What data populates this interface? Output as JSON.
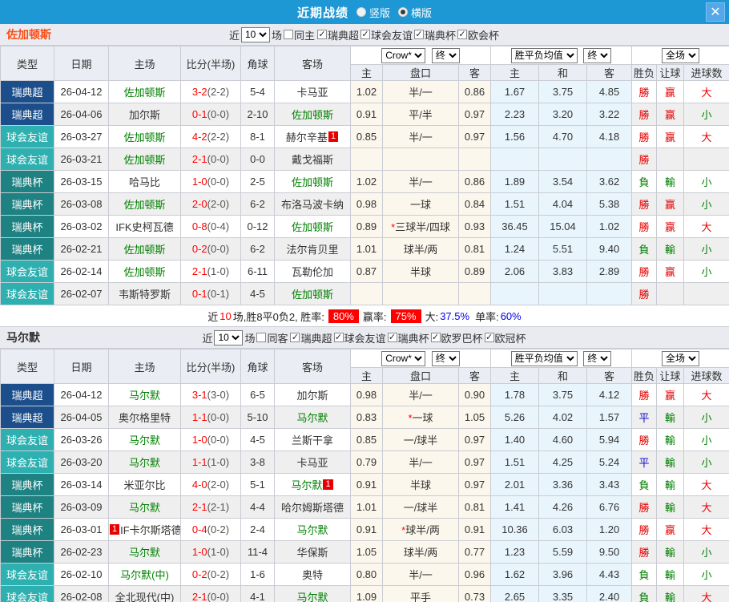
{
  "titlebar": {
    "title": "近期战绩",
    "radio_vertical": "竖版",
    "radio_horizontal": "横版",
    "selected_layout": "横版",
    "close_glyph": "✕"
  },
  "labels": {
    "near": "近",
    "games": "场"
  },
  "table_header": {
    "cols": [
      "类型",
      "日期",
      "主场",
      "比分(半场)",
      "角球",
      "客场"
    ],
    "dd_odds_company": "Crow*",
    "dd_final": "终",
    "dd_avg": "胜平负均值",
    "dd_scope": "全场",
    "subcols": [
      "主",
      "盘口",
      "客",
      "主",
      "和",
      "客",
      "胜负",
      "让球",
      "进球数"
    ]
  },
  "league_colors": {
    "瑞典超": "#1b4e8b",
    "球会友谊": "#2fb0b0",
    "瑞典杯": "#1e8182"
  },
  "colors": {
    "titlebar": "#1e97d5",
    "win": "#e60000",
    "lose": "#008000",
    "draw": "#1414cc",
    "score": "#ff0000",
    "cream_col": "#fcf7ec",
    "pale_col": "#e9f5fc"
  },
  "sections": [
    {
      "team": "佐加顿斯",
      "team_color": "#ff4b12",
      "filters": {
        "count": "10",
        "same_label": "同主",
        "same_checked": false,
        "leagues": [
          {
            "label": "瑞典超",
            "checked": true
          },
          {
            "label": "球会友谊",
            "checked": true
          },
          {
            "label": "瑞典杯",
            "checked": true
          },
          {
            "label": "欧会杯",
            "checked": true
          }
        ]
      },
      "rows": [
        {
          "league": "瑞典超",
          "date": "26-04-12",
          "home": "佐加顿斯",
          "home_self": true,
          "home_badge": "",
          "home_badge_before": false,
          "score": "3-2",
          "half": "(2-2)",
          "corner": "5-4",
          "away": "卡马亚",
          "away_self": false,
          "away_badge": "",
          "o1": "1.02",
          "pan": "半/一",
          "o2": "0.86",
          "a1": "1.67",
          "a2": "3.75",
          "a3": "4.85",
          "wdl": "勝",
          "cover": "赢",
          "ou": "大"
        },
        {
          "league": "瑞典超",
          "date": "26-04-06",
          "home": "加尔斯",
          "home_self": false,
          "home_badge": "",
          "home_badge_before": false,
          "score": "0-1",
          "half": "(0-0)",
          "corner": "2-10",
          "away": "佐加顿斯",
          "away_self": true,
          "away_badge": "",
          "o1": "0.91",
          "pan": "平/半",
          "o2": "0.97",
          "a1": "2.23",
          "a2": "3.20",
          "a3": "3.22",
          "wdl": "勝",
          "cover": "赢",
          "ou": "小"
        },
        {
          "league": "球会友谊",
          "date": "26-03-27",
          "home": "佐加顿斯",
          "home_self": true,
          "home_badge": "",
          "home_badge_before": false,
          "score": "4-2",
          "half": "(2-2)",
          "corner": "8-1",
          "away": "赫尔辛基",
          "away_self": false,
          "away_badge": "1",
          "o1": "0.85",
          "pan": "半/一",
          "o2": "0.97",
          "a1": "1.56",
          "a2": "4.70",
          "a3": "4.18",
          "wdl": "勝",
          "cover": "赢",
          "ou": "大"
        },
        {
          "league": "球会友谊",
          "date": "26-03-21",
          "home": "佐加顿斯",
          "home_self": true,
          "home_badge": "",
          "home_badge_before": false,
          "score": "2-1",
          "half": "(0-0)",
          "corner": "0-0",
          "away": "戴戈福斯",
          "away_self": false,
          "away_badge": "",
          "o1": "",
          "pan": "",
          "o2": "",
          "a1": "",
          "a2": "",
          "a3": "",
          "wdl": "勝",
          "cover": "",
          "ou": ""
        },
        {
          "league": "瑞典杯",
          "date": "26-03-15",
          "home": "哈马比",
          "home_self": false,
          "home_badge": "",
          "home_badge_before": false,
          "score": "1-0",
          "half": "(0-0)",
          "corner": "2-5",
          "away": "佐加顿斯",
          "away_self": true,
          "away_badge": "",
          "o1": "1.02",
          "pan": "半/一",
          "o2": "0.86",
          "a1": "1.89",
          "a2": "3.54",
          "a3": "3.62",
          "wdl": "負",
          "cover": "輸",
          "ou": "小"
        },
        {
          "league": "瑞典杯",
          "date": "26-03-08",
          "home": "佐加顿斯",
          "home_self": true,
          "home_badge": "",
          "home_badge_before": false,
          "score": "2-0",
          "half": "(2-0)",
          "corner": "6-2",
          "away": "布洛马波卡纳",
          "away_self": false,
          "away_badge": "",
          "o1": "0.98",
          "pan": "一球",
          "o2": "0.84",
          "a1": "1.51",
          "a2": "4.04",
          "a3": "5.38",
          "wdl": "勝",
          "cover": "赢",
          "ou": "小"
        },
        {
          "league": "瑞典杯",
          "date": "26-03-02",
          "home": "IFK史柯瓦德",
          "home_self": false,
          "home_badge": "",
          "home_badge_before": false,
          "score": "0-8",
          "half": "(0-4)",
          "corner": "0-12",
          "away": "佐加顿斯",
          "away_self": true,
          "away_badge": "",
          "o1": "0.89",
          "pan": "*三球半/四球",
          "o2": "0.93",
          "a1": "36.45",
          "a2": "15.04",
          "a3": "1.02",
          "wdl": "勝",
          "cover": "赢",
          "ou": "大"
        },
        {
          "league": "瑞典杯",
          "date": "26-02-21",
          "home": "佐加顿斯",
          "home_self": true,
          "home_badge": "",
          "home_badge_before": false,
          "score": "0-2",
          "half": "(0-0)",
          "corner": "6-2",
          "away": "法尔肯贝里",
          "away_self": false,
          "away_badge": "",
          "o1": "1.01",
          "pan": "球半/两",
          "o2": "0.81",
          "a1": "1.24",
          "a2": "5.51",
          "a3": "9.40",
          "wdl": "負",
          "cover": "輸",
          "ou": "小"
        },
        {
          "league": "球会友谊",
          "date": "26-02-14",
          "home": "佐加顿斯",
          "home_self": true,
          "home_badge": "",
          "home_badge_before": false,
          "score": "2-1",
          "half": "(1-0)",
          "corner": "6-11",
          "away": "瓦勒伦加",
          "away_self": false,
          "away_badge": "",
          "o1": "0.87",
          "pan": "半球",
          "o2": "0.89",
          "a1": "2.06",
          "a2": "3.83",
          "a3": "2.89",
          "wdl": "勝",
          "cover": "赢",
          "ou": "小"
        },
        {
          "league": "球会友谊",
          "date": "26-02-07",
          "home": "韦斯特罗斯",
          "home_self": false,
          "home_badge": "",
          "home_badge_before": false,
          "score": "0-1",
          "half": "(0-1)",
          "corner": "4-5",
          "away": "佐加顿斯",
          "away_self": true,
          "away_badge": "",
          "o1": "",
          "pan": "",
          "o2": "",
          "a1": "",
          "a2": "",
          "a3": "",
          "wdl": "勝",
          "cover": "",
          "ou": ""
        }
      ],
      "summary": {
        "prefix": "近",
        "count": "10",
        "record": "场,胜8平0负2, 胜率:",
        "win_rate": "80%",
        "profit_label": "赢率:",
        "profit_rate": "75%",
        "big_label": "大:",
        "big_value": "37.5%",
        "single_label": "单率:",
        "single_value": "60%"
      }
    },
    {
      "team": "马尔默",
      "team_color": "#333333",
      "filters": {
        "count": "10",
        "same_label": "同客",
        "same_checked": false,
        "leagues": [
          {
            "label": "瑞典超",
            "checked": true
          },
          {
            "label": "球会友谊",
            "checked": true
          },
          {
            "label": "瑞典杯",
            "checked": true
          },
          {
            "label": "欧罗巴杯",
            "checked": true
          },
          {
            "label": "欧冠杯",
            "checked": true
          }
        ]
      },
      "rows": [
        {
          "league": "瑞典超",
          "date": "26-04-12",
          "home": "马尔默",
          "home_self": true,
          "home_badge": "",
          "home_badge_before": false,
          "score": "3-1",
          "half": "(3-0)",
          "corner": "6-5",
          "away": "加尔斯",
          "away_self": false,
          "away_badge": "",
          "o1": "0.98",
          "pan": "半/一",
          "o2": "0.90",
          "a1": "1.78",
          "a2": "3.75",
          "a3": "4.12",
          "wdl": "勝",
          "cover": "赢",
          "ou": "大"
        },
        {
          "league": "瑞典超",
          "date": "26-04-05",
          "home": "奥尔格里特",
          "home_self": false,
          "home_badge": "",
          "home_badge_before": false,
          "score": "1-1",
          "half": "(0-0)",
          "corner": "5-10",
          "away": "马尔默",
          "away_self": true,
          "away_badge": "",
          "o1": "0.83",
          "pan": "*一球",
          "o2": "1.05",
          "a1": "5.26",
          "a2": "4.02",
          "a3": "1.57",
          "wdl": "平",
          "cover": "輸",
          "ou": "小"
        },
        {
          "league": "球会友谊",
          "date": "26-03-26",
          "home": "马尔默",
          "home_self": true,
          "home_badge": "",
          "home_badge_before": false,
          "score": "1-0",
          "half": "(0-0)",
          "corner": "4-5",
          "away": "兰斯干拿",
          "away_self": false,
          "away_badge": "",
          "o1": "0.85",
          "pan": "一/球半",
          "o2": "0.97",
          "a1": "1.40",
          "a2": "4.60",
          "a3": "5.94",
          "wdl": "勝",
          "cover": "輸",
          "ou": "小"
        },
        {
          "league": "球会友谊",
          "date": "26-03-20",
          "home": "马尔默",
          "home_self": true,
          "home_badge": "",
          "home_badge_before": false,
          "score": "1-1",
          "half": "(1-0)",
          "corner": "3-8",
          "away": "卡马亚",
          "away_self": false,
          "away_badge": "",
          "o1": "0.79",
          "pan": "半/一",
          "o2": "0.97",
          "a1": "1.51",
          "a2": "4.25",
          "a3": "5.24",
          "wdl": "平",
          "cover": "輸",
          "ou": "小"
        },
        {
          "league": "瑞典杯",
          "date": "26-03-14",
          "home": "米亚尔比",
          "home_self": false,
          "home_badge": "",
          "home_badge_before": false,
          "score": "4-0",
          "half": "(2-0)",
          "corner": "5-1",
          "away": "马尔默",
          "away_self": true,
          "away_badge": "1",
          "o1": "0.91",
          "pan": "半球",
          "o2": "0.97",
          "a1": "2.01",
          "a2": "3.36",
          "a3": "3.43",
          "wdl": "負",
          "cover": "輸",
          "ou": "大"
        },
        {
          "league": "瑞典杯",
          "date": "26-03-09",
          "home": "马尔默",
          "home_self": true,
          "home_badge": "",
          "home_badge_before": false,
          "score": "2-1",
          "half": "(2-1)",
          "corner": "4-4",
          "away": "哈尔姆斯塔德",
          "away_self": false,
          "away_badge": "",
          "o1": "1.01",
          "pan": "一/球半",
          "o2": "0.81",
          "a1": "1.41",
          "a2": "4.26",
          "a3": "6.76",
          "wdl": "勝",
          "cover": "輸",
          "ou": "大"
        },
        {
          "league": "瑞典杯",
          "date": "26-03-01",
          "home": "IF卡尔斯塔德",
          "home_self": false,
          "home_badge": "1",
          "home_badge_before": true,
          "score": "0-4",
          "half": "(0-2)",
          "corner": "2-4",
          "away": "马尔默",
          "away_self": true,
          "away_badge": "",
          "o1": "0.91",
          "pan": "*球半/两",
          "o2": "0.91",
          "a1": "10.36",
          "a2": "6.03",
          "a3": "1.20",
          "wdl": "勝",
          "cover": "赢",
          "ou": "大"
        },
        {
          "league": "瑞典杯",
          "date": "26-02-23",
          "home": "马尔默",
          "home_self": true,
          "home_badge": "",
          "home_badge_before": false,
          "score": "1-0",
          "half": "(1-0)",
          "corner": "11-4",
          "away": "华保斯",
          "away_self": false,
          "away_badge": "",
          "o1": "1.05",
          "pan": "球半/两",
          "o2": "0.77",
          "a1": "1.23",
          "a2": "5.59",
          "a3": "9.50",
          "wdl": "勝",
          "cover": "輸",
          "ou": "小"
        },
        {
          "league": "球会友谊",
          "date": "26-02-10",
          "home": "马尔默(中)",
          "home_self": true,
          "home_badge": "",
          "home_badge_before": false,
          "score": "0-2",
          "half": "(0-2)",
          "corner": "1-6",
          "away": "奥特",
          "away_self": false,
          "away_badge": "",
          "o1": "0.80",
          "pan": "半/一",
          "o2": "0.96",
          "a1": "1.62",
          "a2": "3.96",
          "a3": "4.43",
          "wdl": "負",
          "cover": "輸",
          "ou": "小"
        },
        {
          "league": "球会友谊",
          "date": "26-02-08",
          "home": "全北现代(中)",
          "home_self": false,
          "home_badge": "",
          "home_badge_before": false,
          "score": "2-1",
          "half": "(0-0)",
          "corner": "4-1",
          "away": "马尔默",
          "away_self": true,
          "away_badge": "",
          "o1": "1.09",
          "pan": "平手",
          "o2": "0.73",
          "a1": "2.65",
          "a2": "3.35",
          "a3": "2.40",
          "wdl": "負",
          "cover": "輸",
          "ou": "大"
        }
      ],
      "summary": null
    }
  ]
}
